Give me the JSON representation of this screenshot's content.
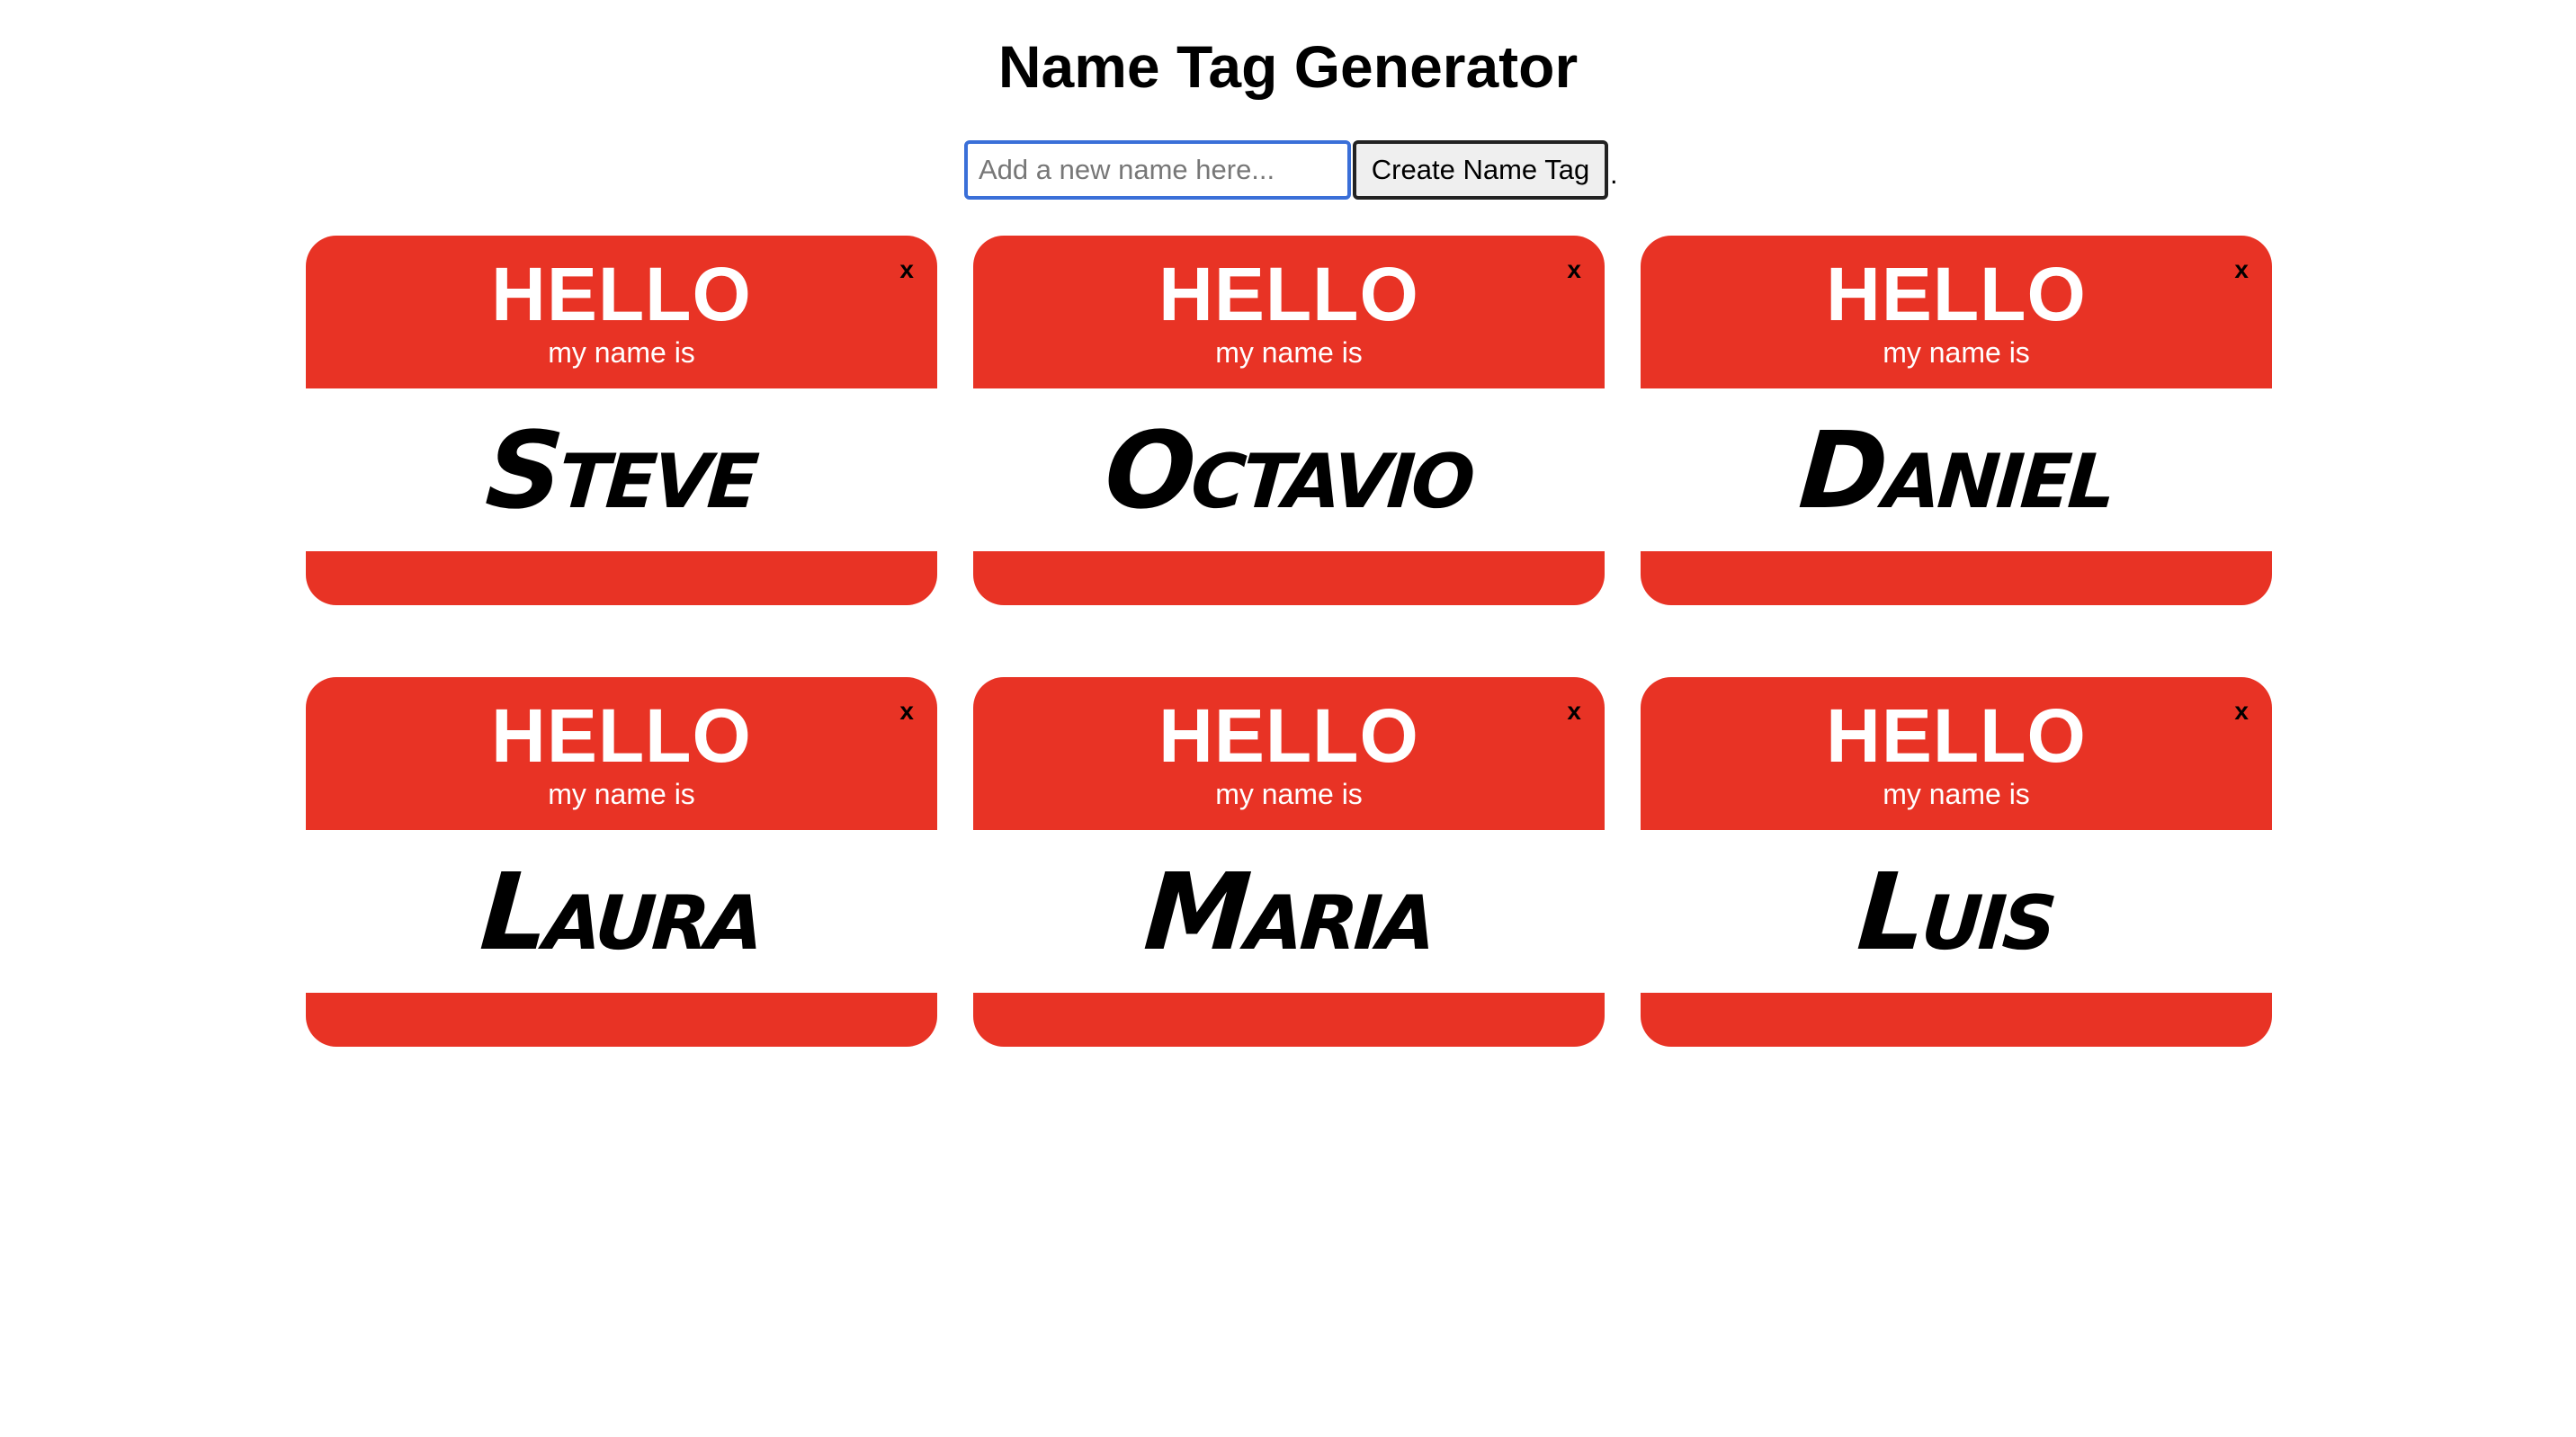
{
  "page": {
    "title": "Name Tag Generator"
  },
  "form": {
    "input_value": "",
    "input_placeholder": "Add a new name here...",
    "button_label": "Create Name Tag",
    "trailing_text": "."
  },
  "tag_labels": {
    "hello": "HELLO",
    "subtitle": "my name is",
    "remove": "x"
  },
  "tags": [
    {
      "name": "Steve"
    },
    {
      "name": "Octavio"
    },
    {
      "name": "Daniel"
    },
    {
      "name": "Laura"
    },
    {
      "name": "Maria"
    },
    {
      "name": "Luis"
    }
  ],
  "colors": {
    "tag_red": "#e83325",
    "input_focus_border": "#3a6fd8",
    "button_background": "#efefef"
  }
}
